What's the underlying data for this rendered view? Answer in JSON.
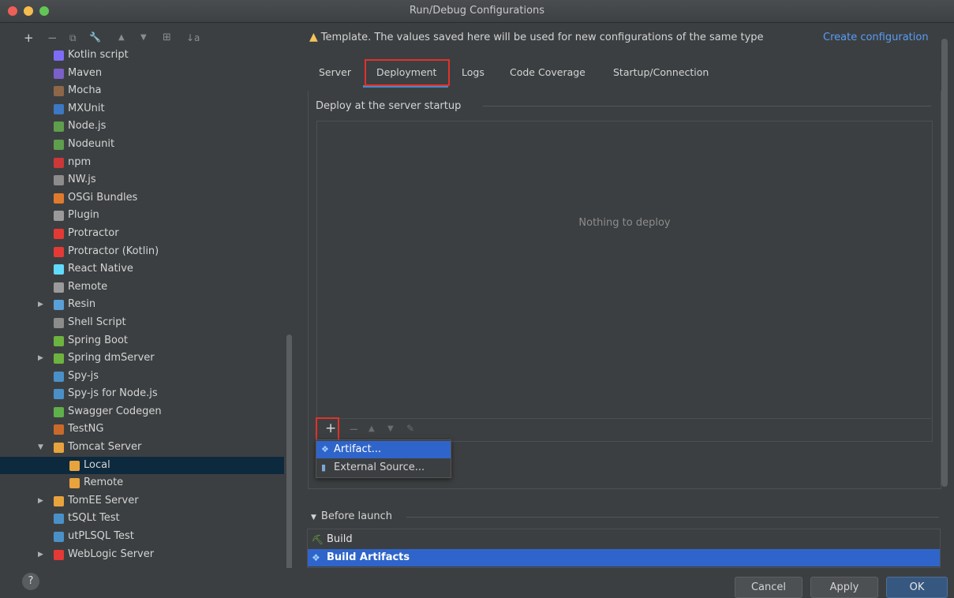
{
  "window": {
    "title": "Run/Debug Configurations"
  },
  "toolbar": {
    "add": "+",
    "remove": "−",
    "copy": "⧉",
    "edit": "🔧",
    "up": "▲",
    "down": "▼",
    "folder": "⊞",
    "sort": "↓a"
  },
  "tree": {
    "items": [
      {
        "label": "Kotlin script",
        "icon": "kotlin-icon",
        "color": "#7f6cf6"
      },
      {
        "label": "Maven",
        "icon": "maven-icon",
        "color": "#7b60c9"
      },
      {
        "label": "Mocha",
        "icon": "mocha-icon",
        "color": "#8d6748"
      },
      {
        "label": "MXUnit",
        "icon": "mxunit-icon",
        "color": "#3c78c3"
      },
      {
        "label": "Node.js",
        "icon": "nodejs-icon",
        "color": "#5f9e4c"
      },
      {
        "label": "Nodeunit",
        "icon": "nodeunit-icon",
        "color": "#5f9e4c"
      },
      {
        "label": "npm",
        "icon": "npm-icon",
        "color": "#cb3837"
      },
      {
        "label": "NW.js",
        "icon": "nwjs-icon",
        "color": "#8c8c8c"
      },
      {
        "label": "OSGi Bundles",
        "icon": "osgi-icon",
        "color": "#e07a2d"
      },
      {
        "label": "Plugin",
        "icon": "plugin-icon",
        "color": "#9a9a9a"
      },
      {
        "label": "Protractor",
        "icon": "protractor-icon",
        "color": "#e53935"
      },
      {
        "label": "Protractor (Kotlin)",
        "icon": "protractor-icon",
        "color": "#e53935"
      },
      {
        "label": "React Native",
        "icon": "react-icon",
        "color": "#61dafb"
      },
      {
        "label": "Remote",
        "icon": "remote-icon",
        "color": "#9a9a9a"
      },
      {
        "label": "Resin",
        "icon": "resin-icon",
        "color": "#5aa0d8"
      },
      {
        "label": "Shell Script",
        "icon": "shell-icon",
        "color": "#8c8c8c"
      },
      {
        "label": "Spring Boot",
        "icon": "spring-boot-icon",
        "color": "#6db33f"
      },
      {
        "label": "Spring dmServer",
        "icon": "spring-dm-icon",
        "color": "#6db33f"
      },
      {
        "label": "Spy-js",
        "icon": "spyjs-icon",
        "color": "#4a90c8"
      },
      {
        "label": "Spy-js for Node.js",
        "icon": "spyjs-node-icon",
        "color": "#4a90c8"
      },
      {
        "label": "Swagger Codegen",
        "icon": "swagger-icon",
        "color": "#5fb04a"
      },
      {
        "label": "TestNG",
        "icon": "testng-icon",
        "color": "#c96a2a"
      },
      {
        "label": "Tomcat Server",
        "icon": "tomcat-icon",
        "color": "#e8a33d"
      },
      {
        "label": "Local",
        "icon": "tomcat-icon",
        "color": "#e8a33d"
      },
      {
        "label": "Remote",
        "icon": "tomcat-icon",
        "color": "#e8a33d"
      },
      {
        "label": "TomEE Server",
        "icon": "tomee-icon",
        "color": "#e8a33d"
      },
      {
        "label": "tSQLt Test",
        "icon": "tsqlt-icon",
        "color": "#4a90c8"
      },
      {
        "label": "utPLSQL Test",
        "icon": "utplsql-icon",
        "color": "#4a90c8"
      },
      {
        "label": "WebLogic Server",
        "icon": "weblogic-icon",
        "color": "#e53935"
      }
    ]
  },
  "notice": {
    "text": "Template. The values saved here will be used for new configurations of the same type",
    "link": "Create configuration"
  },
  "tabs": [
    "Server",
    "Deployment",
    "Logs",
    "Code Coverage",
    "Startup/Connection"
  ],
  "deploy": {
    "section_title": "Deploy at the server startup",
    "empty_text": "Nothing to deploy"
  },
  "popup": {
    "items": [
      "Artifact...",
      "External Source..."
    ]
  },
  "before_launch": {
    "title": "Before launch",
    "items": [
      "Build",
      "Build Artifacts"
    ]
  },
  "footer": {
    "help": "?",
    "cancel": "Cancel",
    "apply": "Apply",
    "ok": "OK"
  }
}
